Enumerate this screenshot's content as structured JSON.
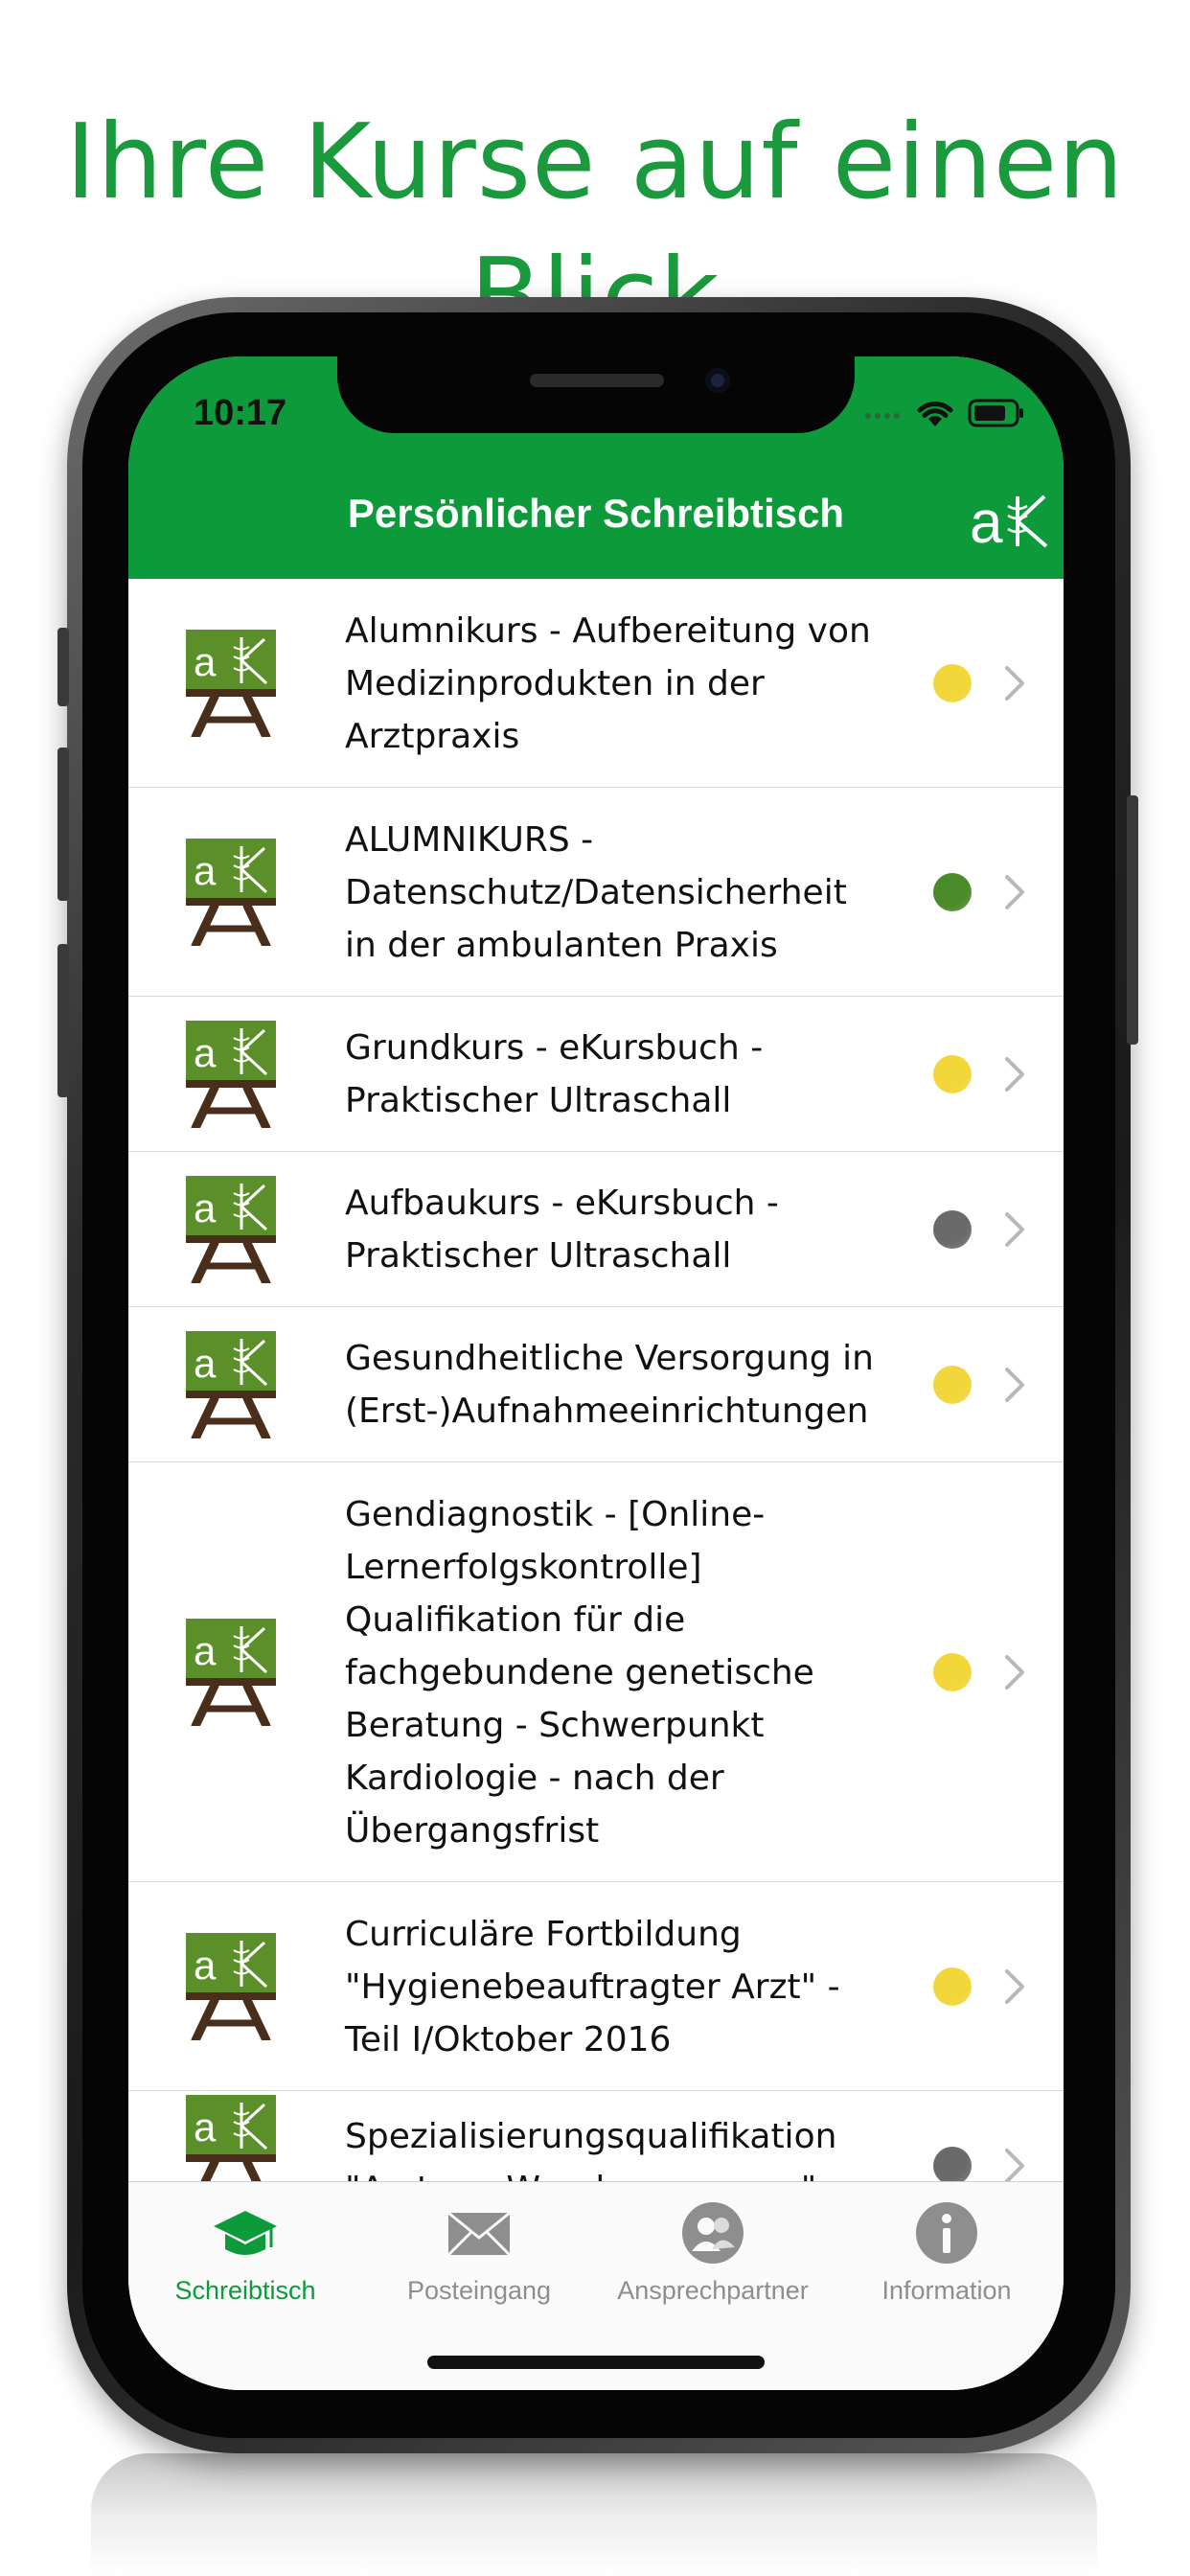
{
  "headline": "Ihre Kurse auf einen Blick",
  "status_bar": {
    "time": "10:17"
  },
  "header": {
    "title": "Persönlicher Schreibtisch",
    "logo_text": "aK"
  },
  "colors": {
    "brand_green": "#0c9a3b",
    "headline_green": "#1a9a3c",
    "status_yellow": "#f2d63a",
    "status_green": "#4a8a2a",
    "status_gray": "#6a6a6a",
    "tab_active": "#0c9a3b",
    "tab_inactive": "#8e8e8e"
  },
  "courses": [
    {
      "title": "Alumnikurs - Aufbereitung von Medizinprodukten in der Arztpraxis",
      "status": "yellow"
    },
    {
      "title": "ALUMNIKURS - Datenschutz/Datensicherheit in der ambulanten Praxis",
      "status": "green"
    },
    {
      "title": "Grundkurs - eKursbuch - Praktischer Ultraschall",
      "status": "yellow"
    },
    {
      "title": "Aufbaukurs - eKursbuch - Praktischer Ultraschall",
      "status": "gray"
    },
    {
      "title": "Gesundheitliche Versorgung in (Erst-)Aufnahmeeinrichtungen",
      "status": "yellow"
    },
    {
      "title": "Gendiagnostik - [Online-Lernerfolgskontrolle] Qualifikation für die fachgebundene genetische Beratung - Schwerpunkt Kardiologie - nach der Übergangsfrist",
      "status": "yellow"
    },
    {
      "title": "Curriculäre Fortbildung \"Hygienebeauftragter Arzt\" - Teil I/Oktober 2016",
      "status": "yellow"
    },
    {
      "title": "Spezialisierungsqualifikation \"Arzt zur Wundversorgung\"",
      "status": "gray"
    }
  ],
  "tabs": [
    {
      "label": "Schreibtisch",
      "icon": "graduation-cap-icon",
      "active": true
    },
    {
      "label": "Posteingang",
      "icon": "envelope-icon",
      "active": false
    },
    {
      "label": "Ansprechpartner",
      "icon": "contacts-icon",
      "active": false
    },
    {
      "label": "Information",
      "icon": "info-icon",
      "active": false
    }
  ]
}
